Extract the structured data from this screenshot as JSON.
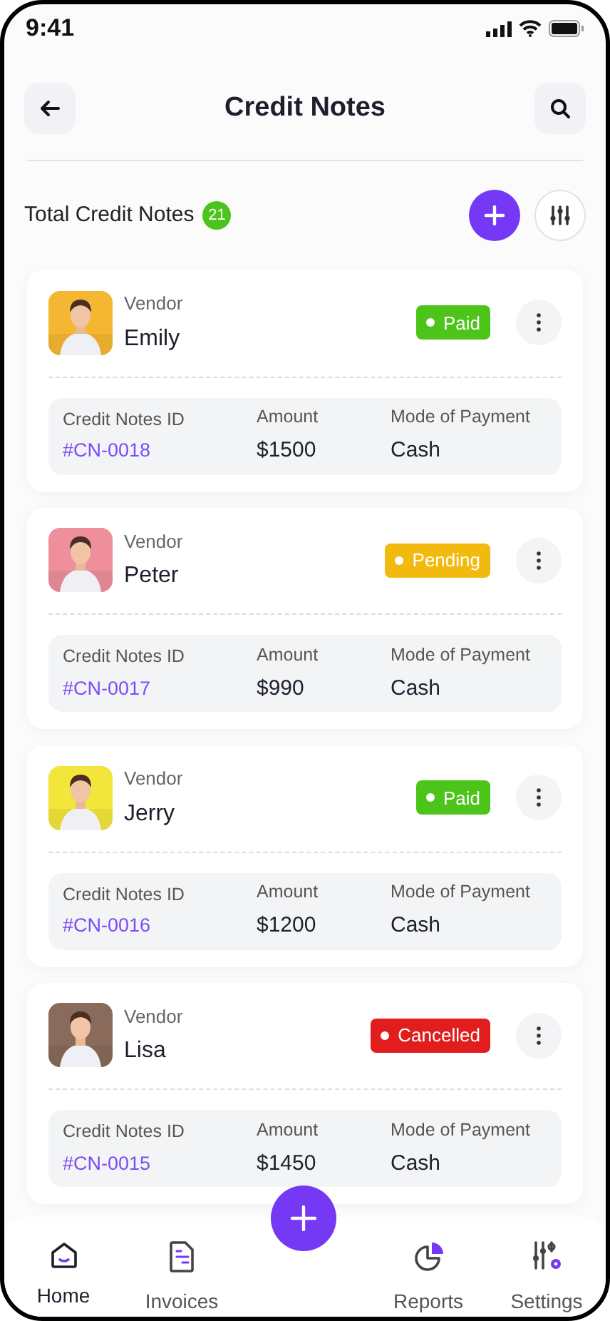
{
  "status_bar": {
    "time": "9:41"
  },
  "header": {
    "title": "Credit Notes"
  },
  "summary": {
    "label": "Total Credit Notes",
    "count": "21"
  },
  "notes": [
    {
      "vendor_label": "Vendor",
      "vendor": "Emily",
      "status": {
        "kind": "paid",
        "label": "Paid"
      },
      "id_label": "Credit Notes ID",
      "id": "#CN-0018",
      "amount_label": "Amount",
      "amount": "$1500",
      "mode_label": "Mode of Payment",
      "mode": "Cash"
    },
    {
      "vendor_label": "Vendor",
      "vendor": "Peter",
      "status": {
        "kind": "pending",
        "label": "Pending"
      },
      "id_label": "Credit Notes ID",
      "id": "#CN-0017",
      "amount_label": "Amount",
      "amount": "$990",
      "mode_label": "Mode of Payment",
      "mode": "Cash"
    },
    {
      "vendor_label": "Vendor",
      "vendor": "Jerry",
      "status": {
        "kind": "paid",
        "label": "Paid"
      },
      "id_label": "Credit Notes ID",
      "id": "#CN-0016",
      "amount_label": "Amount",
      "amount": "$1200",
      "mode_label": "Mode of Payment",
      "mode": "Cash"
    },
    {
      "vendor_label": "Vendor",
      "vendor": "Lisa",
      "status": {
        "kind": "cancelled",
        "label": "Cancelled"
      },
      "id_label": "Credit Notes ID",
      "id": "#CN-0015",
      "amount_label": "Amount",
      "amount": "$1450",
      "mode_label": "Mode of Payment",
      "mode": "Cash"
    }
  ],
  "bottom_nav": [
    {
      "kind": "home",
      "label": "Home",
      "selected": true
    },
    {
      "kind": "invoices",
      "label": "Invoices",
      "selected": false
    },
    {
      "kind": "reports",
      "label": "Reports",
      "selected": false
    },
    {
      "kind": "settings",
      "label": "Settings",
      "selected": false
    }
  ]
}
